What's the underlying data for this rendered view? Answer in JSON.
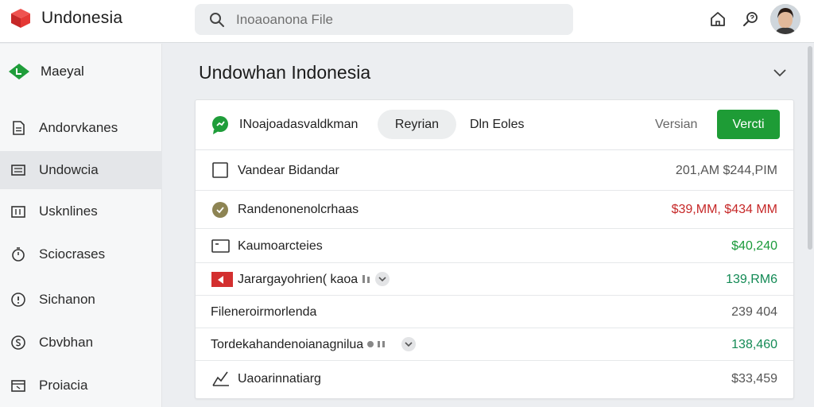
{
  "app": {
    "title": "Undonesia",
    "colors": {
      "brand": "#d32f2f",
      "accent": "#1e9c36",
      "positive": "#1a9a3a",
      "negative": "#c62828"
    }
  },
  "search": {
    "placeholder": "Inoaoanona File",
    "icon": "search-icon"
  },
  "top_icons": [
    "home-icon",
    "search-help-icon"
  ],
  "sidebar": {
    "header": {
      "label": "Maeyal",
      "icon": "green-diamond-icon"
    },
    "items": [
      {
        "label": "Andorvkanes",
        "icon": "document-icon"
      },
      {
        "label": "Undowcia",
        "icon": "list-icon",
        "active": true
      },
      {
        "label": "Usknlines",
        "icon": "grid-panel-icon"
      },
      {
        "label": "Sciocrases",
        "icon": "timer-icon"
      },
      {
        "label": "Sichanon",
        "icon": "info-circle-icon"
      },
      {
        "label": "Cbvbhan",
        "icon": "currency-circle-icon"
      },
      {
        "label": "Proiacia",
        "icon": "calendar-icon"
      }
    ]
  },
  "main": {
    "title": "Undowhan Indonesia",
    "toolbar": {
      "title": "INoajoadasvaldkman",
      "pill_label": "Reyrian",
      "link_label": "Dln Eoles",
      "version_label": "Versian",
      "button_label": "Vercti"
    },
    "rows": [
      {
        "name": "Vandear Bidandar",
        "value": "201,AM  $244,PIM",
        "value_color": "gray",
        "icon": "checkbox-icon"
      },
      {
        "name": "Randenonenolcrhaas",
        "value": "$39,MM,  $434 MM",
        "value_color": "red",
        "icon": "olive-circle-icon"
      },
      {
        "name": "Kaumoarcteies",
        "value": "$40,240",
        "value_color": "green",
        "icon": "window-icon"
      },
      {
        "name": "Jarargayohrien( kaoa",
        "value": "139,RM6",
        "value_color": "teal",
        "icon": "flag-icon",
        "extras": true
      },
      {
        "name": "Fileneroirmorlenda",
        "value": "239 404",
        "value_color": "gray"
      },
      {
        "name": "Tordekahandenoianagn",
        "name_suffix": "ilua",
        "value": "138,460",
        "value_color": "teal",
        "extras": true
      },
      {
        "name": "Uaoarinnatiarg",
        "value": "$33,459",
        "value_color": "gray",
        "icon": "chart-icon"
      }
    ]
  }
}
